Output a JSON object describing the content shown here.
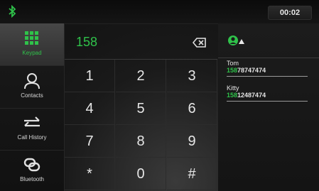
{
  "status": {
    "bluetooth_icon": "bluetooth-icon",
    "time": "00:02"
  },
  "sidebar": {
    "items": [
      {
        "label": "Keypad",
        "icon": "keypad-icon",
        "active": true
      },
      {
        "label": "Contacts",
        "icon": "person-icon"
      },
      {
        "label": "Call History",
        "icon": "arrows-icon"
      },
      {
        "label": "Bluetooth",
        "icon": "link-icon"
      }
    ]
  },
  "dialer": {
    "number": "158",
    "keys": [
      "1",
      "2",
      "3",
      "4",
      "5",
      "6",
      "7",
      "8",
      "9",
      "*",
      "0",
      "#"
    ]
  },
  "contacts": {
    "results": [
      {
        "name": "Tom",
        "match": "158",
        "rest": "78747474"
      },
      {
        "name": "Kitty",
        "match": "158",
        "rest": "12487474"
      }
    ]
  },
  "colors": {
    "accent": "#2fc24a",
    "background": "#141414"
  }
}
